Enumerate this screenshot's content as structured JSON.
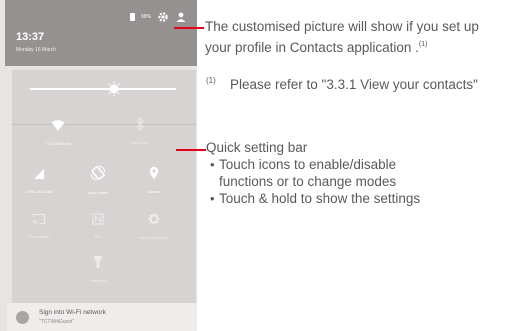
{
  "phone": {
    "status": {
      "battery_pct": "99%"
    },
    "time": "13:37",
    "date": "Monday 16 March",
    "tiles": [
      {
        "label": "TCTWifiGuest",
        "icon": "wifi-icon"
      },
      {
        "label": "Bluetooth",
        "icon": "bluetooth-icon"
      },
      {
        "label": "CHN-UNICOM",
        "icon": "signal-icon"
      },
      {
        "label": "Auto-rotate",
        "icon": "rotate-icon"
      },
      {
        "label": "Location",
        "icon": "location-icon"
      },
      {
        "label": "Cast screen",
        "icon": "cast-icon"
      },
      {
        "label": "NFC",
        "icon": "nfc-icon"
      },
      {
        "label": "Auto brightness",
        "icon": "brightness-icon"
      },
      {
        "label": "Flashlight",
        "icon": "flashlight-icon"
      }
    ],
    "notification": {
      "title": "Sign into Wi-Fi network",
      "subtitle": "\"TCTWifiGuest\""
    }
  },
  "annotations": {
    "profile_line1": "The customised picture will show if you set up",
    "profile_line2": "your profile in Contacts application .",
    "footnote_mark": "(1)",
    "footnote_number": "(1)",
    "footnote_text": "Please refer to \"3.3.1 View your contacts\"",
    "qs_heading": "Quick setting bar",
    "bullets": [
      [
        "Touch icons to enable/disable",
        "functions or to change modes"
      ],
      [
        "Touch & hold to show the settings"
      ]
    ]
  },
  "colors": {
    "accent_line": "#e2001a",
    "body_text": "#58595b"
  }
}
